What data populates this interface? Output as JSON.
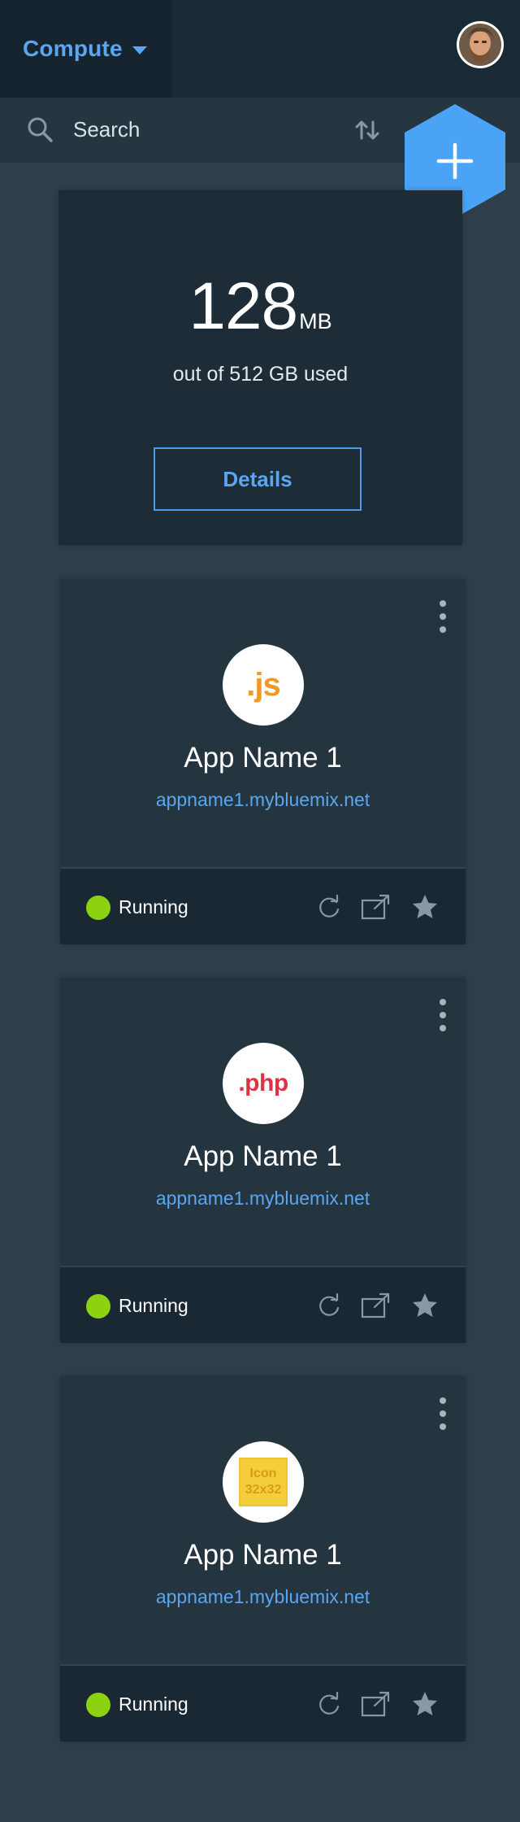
{
  "header": {
    "compute_label": "Compute",
    "avatar_alt": "User avatar"
  },
  "search": {
    "placeholder": "Search"
  },
  "storage": {
    "amount": "128",
    "unit": "MB",
    "subtitle": "out of 512 GB used",
    "details_label": "Details"
  },
  "apps": [
    {
      "logo": ".js",
      "name": "App Name 1",
      "url": "appname1.mybluemix.net",
      "status": "Running"
    },
    {
      "logo": ".php",
      "name": "App Name 1",
      "url": "appname1.mybluemix.net",
      "status": "Running"
    },
    {
      "logo_line1": "Icon",
      "logo_line2": "32x32",
      "name": "App Name 1",
      "url": "appname1.mybluemix.net",
      "status": "Running"
    }
  ],
  "icons": {
    "caret": "chevron-down-icon",
    "search": "search-icon",
    "sort": "sort-icon",
    "add": "plus-icon",
    "overflow": "kebab-icon",
    "restart": "restart-icon",
    "launch": "launch-icon",
    "favorite": "star-icon"
  },
  "colors": {
    "accent": "#5aa6f0",
    "status_running": "#8cd211",
    "js_logo": "#f09a24",
    "php_logo": "#e23044",
    "fab": "#4aa3f5"
  }
}
